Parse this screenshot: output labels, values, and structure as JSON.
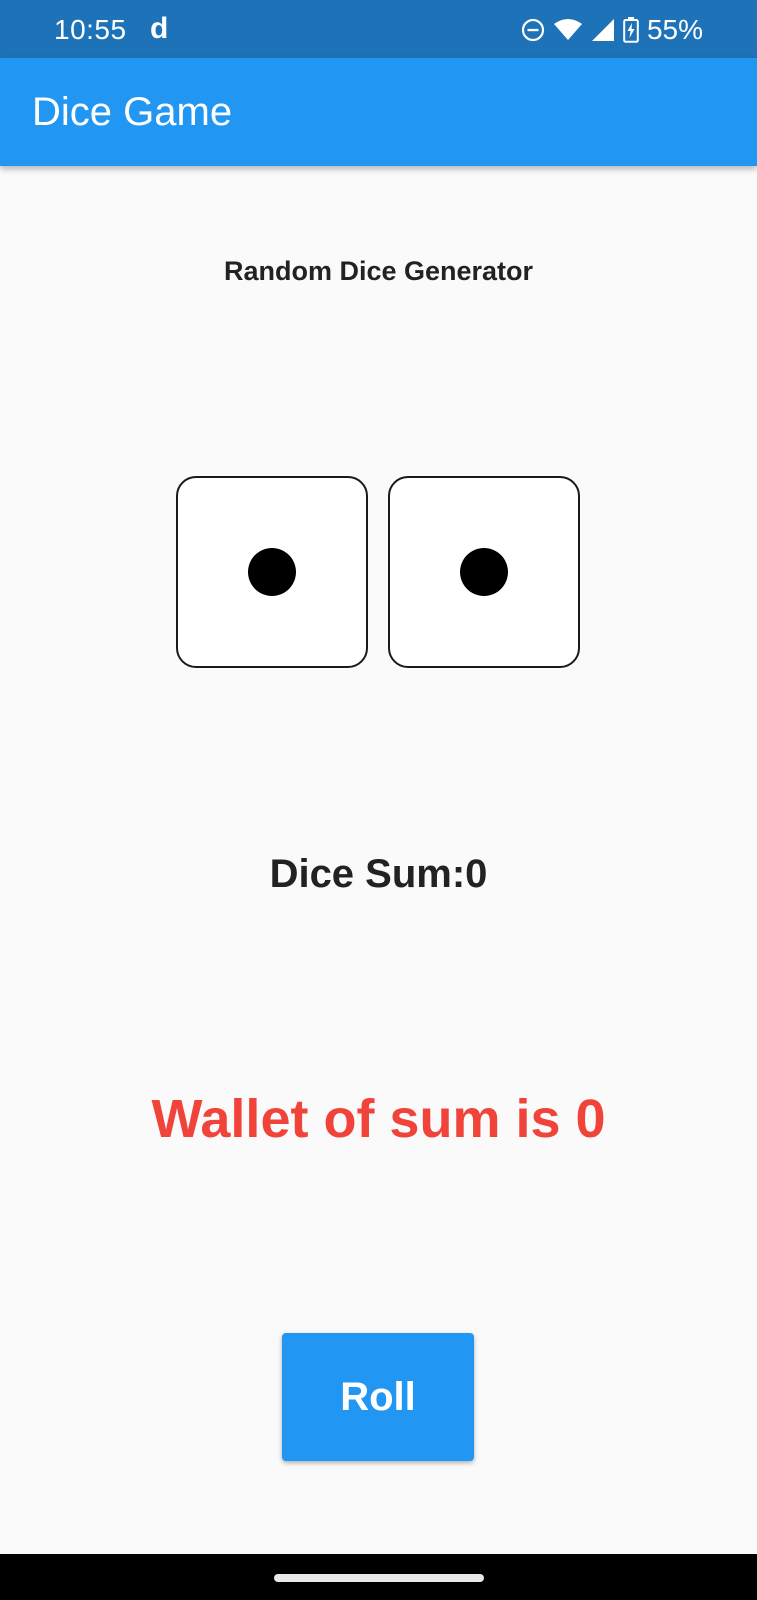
{
  "status_bar": {
    "time": "10:55",
    "notification_letter": "d",
    "battery_percent": "55%",
    "icons": [
      "do-not-disturb-icon",
      "wifi-icon",
      "cell-signal-icon",
      "battery-charging-icon"
    ]
  },
  "app_bar": {
    "title": "Dice Game"
  },
  "main": {
    "subtitle": "Random Dice Generator",
    "dice": [
      {
        "value": 1
      },
      {
        "value": 1
      }
    ],
    "dice_sum_text": "Dice Sum:0",
    "wallet_text": "Wallet of sum is 0",
    "roll_label": "Roll"
  },
  "colors": {
    "status_bar": "#1d72b8",
    "app_bar": "#2196f3",
    "background": "#fafafa",
    "wallet_text": "#f0443a",
    "button": "#2196f3"
  }
}
